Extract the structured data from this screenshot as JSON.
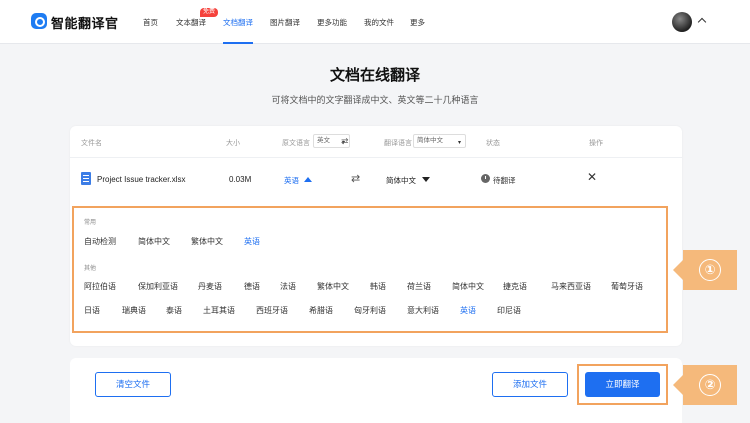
{
  "brand": {
    "name": "智能翻译官"
  },
  "nav": {
    "items": [
      {
        "label": "首页"
      },
      {
        "label": "文本翻译",
        "badge": "免费"
      },
      {
        "label": "文档翻译",
        "active": true
      },
      {
        "label": "图片翻译"
      },
      {
        "label": "更多功能"
      },
      {
        "label": "我的文件"
      },
      {
        "label": "更多"
      }
    ]
  },
  "header": {
    "title": "文档在线翻译",
    "subtitle": "可将文档中的文字翻译成中文、英文等二十几种语言"
  },
  "table": {
    "headers": {
      "filename": "文件名",
      "size": "大小",
      "source_lang": "原文语言",
      "source_select": "英文",
      "target_lang": "翻译语言",
      "target_select": "简体中文",
      "status": "状态",
      "action": "操作"
    },
    "row": {
      "filename": "Project Issue tracker.xlsx",
      "size": "0.03M",
      "source": "英语",
      "target": "简体中文",
      "status": "待翻译"
    }
  },
  "lang_panel": {
    "common_label": "常用",
    "common": [
      "自动检测",
      "简体中文",
      "繁体中文",
      "英语"
    ],
    "other_label": "其他",
    "other_row1": [
      "阿拉伯语",
      "保加利亚语",
      "丹麦语",
      "德语",
      "法语",
      "繁体中文",
      "韩语",
      "荷兰语",
      "简体中文",
      "捷克语",
      "马来西亚语",
      "葡萄牙语"
    ],
    "other_row2": [
      "日语",
      "瑞典语",
      "泰语",
      "土耳其语",
      "西班牙语",
      "希腊语",
      "匈牙利语",
      "意大利语",
      "英语",
      "印尼语"
    ],
    "selected": "英语"
  },
  "actions": {
    "clear": "清空文件",
    "add": "添加文件",
    "translate": "立即翻译"
  },
  "callouts": {
    "one": "①",
    "two": "②"
  },
  "colors": {
    "accent": "#1e6ff1",
    "highlight": "#f2a35e",
    "badge": "#f5423c"
  }
}
